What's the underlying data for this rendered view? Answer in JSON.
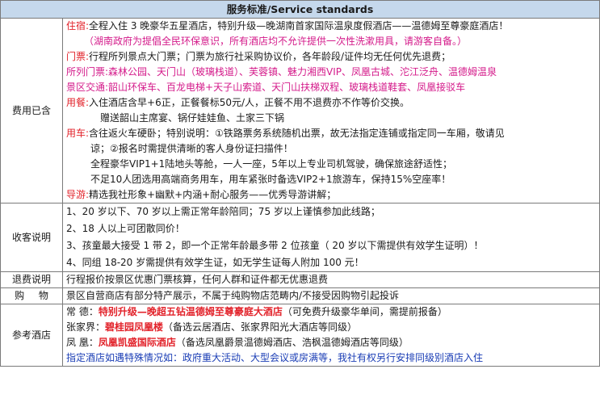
{
  "header": "服务标准/Service standards",
  "fees": {
    "label": "费用已含",
    "stay_title": "住宿:",
    "stay_text": "全程入住 3 晚豪华五星酒店，特别升级—晚湖南首家国际温泉度假酒店——温德姆至尊豪庭酒店！",
    "stay_note": "（湖南政府为提倡全民环保意识，所有酒店均不允许提供一次性洗漱用具，请游客自备。）",
    "tickets_title": "门票:",
    "tickets_text": "行程所列景点大门票；门票为旅行社采购协议价，各年龄段/证件均无任何优先退费；",
    "attractions_title": "所列门票:",
    "attractions_text": "森林公园、天门山（玻璃栈道）、芙蓉镇、魅力湘西VIP、凤凰古城、沱江泛舟、温德姆温泉",
    "transport_title": "景区交通:",
    "transport_text": "韶山环保车、百龙电梯+天子山索道、天门山扶梯双程、玻璃栈道鞋套、凤凰接驳车",
    "meals_title": "用餐:",
    "meals_text": "入住酒店含早+6正，正餐餐标50元/人，正餐不用不退费亦不作等价交换。",
    "meals_text2": "赠送韶山主席宴、锅仔娃娃鱼、土家三下锅",
    "car_title": "用车:",
    "car_text": "含往返火车硬卧；特别说明：①铁路票务系统随机出票，故无法指定连铺或指定同一车厢，敬请见",
    "car_text2": "谅；②报名时需提供清晰的客人身份证扫描件！",
    "car_text3": "全程豪华VIP1+1陆地头等舱，一人一座，5年以上专业司机驾驶，确保旅途舒适性；",
    "car_text4": "不足10人团选用高端商务用车，用车紧张时备选VIP2+1旅游车，保持15%空座率！",
    "guide_title": "导游:",
    "guide_text": "精选我社形象+幽默+内涵+耐心服务——优秀导游讲解；"
  },
  "admission": {
    "label": "收客说明",
    "items": [
      "1、20 岁以下、70 岁以上需正常年龄陪同；75 岁以上谨慎参加此线路；",
      "2、18 人以上可团散同价！",
      "3、孩童最大接受 1 带 2，即一个正常年龄最多带 2 位孩童（ 20 岁以下需提供有效学生证明）！",
      "4、同组 18-20 岁需提供有效学生证，如无学生证每人附加 100 元！"
    ]
  },
  "refund": {
    "label": "退费说明",
    "text": "行程报价按景区优惠门票核算，任何人群和证件都无优惠退费"
  },
  "shopping": {
    "label": "购 物",
    "text": "景区自营商店有部分特产展示，不属于纯购物店范畴内/不接受因购物引起投诉"
  },
  "hotels": {
    "label": "参考酒店",
    "rows": [
      {
        "city": "常 德：",
        "hotel": "特别升级—晚超五钻温德姆至尊豪庭大酒店",
        "note": "（可免费升级豪华单间，需提前报备）"
      },
      {
        "city": "张家界：",
        "hotel": "碧桂园凤凰楼",
        "note": "（备选云居酒店、张家界阳光大酒店等同级）"
      },
      {
        "city": "凤 凰：",
        "hotel": "凤凰凯盛国际酒店",
        "note": "（备选凤凰爵景温德姆酒店、浩枫温德姆酒店等同级）"
      }
    ],
    "footnote": "指定酒店如遇特殊情况如：政府重大活动、大型会议或房满等，我社有权另行安排同级别酒店入住"
  }
}
